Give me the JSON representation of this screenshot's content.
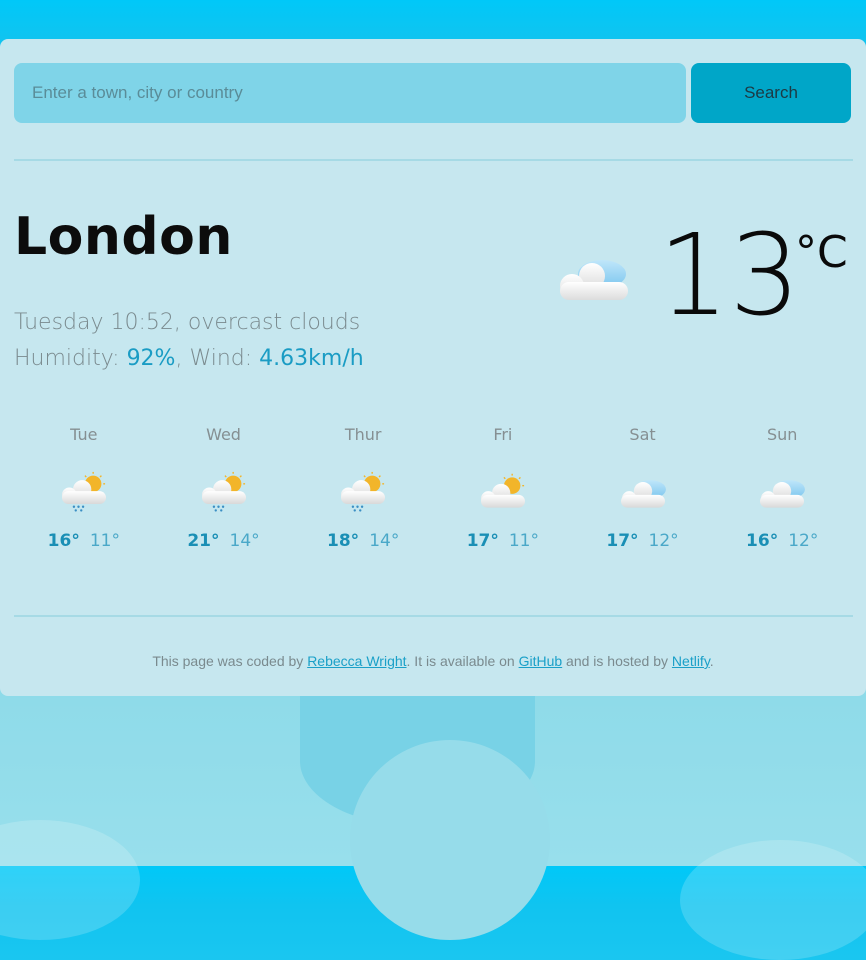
{
  "search": {
    "placeholder": "Enter a town, city or country",
    "value": "",
    "button_label": "Search"
  },
  "current": {
    "city": "London",
    "day_time": "Tuesday 10:52",
    "description": "overcast clouds",
    "humidity_label": "Humidity: ",
    "humidity": "92%",
    "wind_label": "Wind: ",
    "wind": "4.63km/h",
    "temperature": "13",
    "unit": "°C",
    "icon": "overcast-clouds-icon"
  },
  "forecast": [
    {
      "day": "Tue",
      "max": "16°",
      "min": "11°",
      "icon": "sun-cloud-rain-icon"
    },
    {
      "day": "Wed",
      "max": "21°",
      "min": "14°",
      "icon": "sun-cloud-rain-icon"
    },
    {
      "day": "Thur",
      "max": "18°",
      "min": "14°",
      "icon": "sun-cloud-rain-icon"
    },
    {
      "day": "Fri",
      "max": "17°",
      "min": "11°",
      "icon": "sun-cloud-icon"
    },
    {
      "day": "Sat",
      "max": "17°",
      "min": "12°",
      "icon": "overcast-clouds-icon"
    },
    {
      "day": "Sun",
      "max": "16°",
      "min": "12°",
      "icon": "overcast-clouds-icon"
    }
  ],
  "footer": {
    "text1": "This page was coded by ",
    "author_link": "Rebecca Wright",
    "text2": ". It is available on ",
    "github_link": "GitHub",
    "text3": " and is hosted by ",
    "netlify_link": "Netlify",
    "text4": "."
  },
  "colors": {
    "accent": "#1a9cc4",
    "card": "#c6e7ef",
    "button": "#00a6c8",
    "input": "#7fd4e8"
  }
}
